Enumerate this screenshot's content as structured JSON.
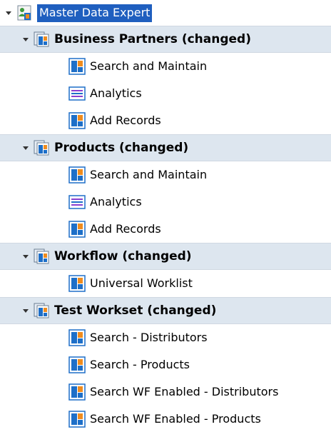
{
  "root": {
    "label": "Master Data Expert",
    "expanded": true,
    "icon": "users-folder-icon"
  },
  "groups": [
    {
      "label": "Business Partners (changed)",
      "expanded": true,
      "icon": "workset-icon",
      "items": [
        {
          "label": "Search and Maintain",
          "icon": "iview-icon"
        },
        {
          "label": "Analytics",
          "icon": "list-icon"
        },
        {
          "label": "Add Records",
          "icon": "iview-icon"
        }
      ]
    },
    {
      "label": "Products (changed)",
      "expanded": true,
      "icon": "workset-icon",
      "items": [
        {
          "label": "Search and Maintain",
          "icon": "iview-icon"
        },
        {
          "label": "Analytics",
          "icon": "list-icon"
        },
        {
          "label": "Add Records",
          "icon": "iview-icon"
        }
      ]
    },
    {
      "label": "Workflow (changed)",
      "expanded": true,
      "icon": "workset-icon",
      "items": [
        {
          "label": "Universal Worklist",
          "icon": "iview-icon"
        }
      ]
    },
    {
      "label": "Test Workset (changed)",
      "expanded": true,
      "icon": "workset-icon",
      "items": [
        {
          "label": "Search - Distributors",
          "icon": "iview-icon"
        },
        {
          "label": "Search - Products",
          "icon": "iview-icon"
        },
        {
          "label": "Search WF Enabled - Distributors",
          "icon": "iview-icon"
        },
        {
          "label": "Search WF Enabled - Products",
          "icon": "iview-icon"
        }
      ]
    }
  ],
  "colors": {
    "selection": "#1f5fbf",
    "group_band": "#dde6ef",
    "iview_blue": "#1e6fc8",
    "iview_orange": "#f08c1e"
  }
}
